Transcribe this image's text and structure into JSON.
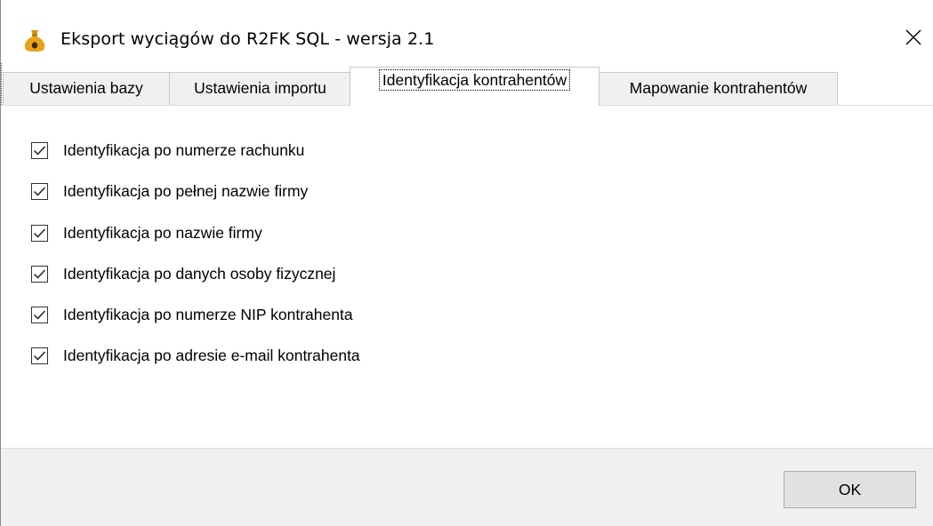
{
  "window": {
    "title": "Eksport wyciągów do R2FK SQL - wersja 2.1",
    "app_icon": "money-bag-icon",
    "close_icon": "close-icon"
  },
  "tabs": [
    {
      "label": "Ustawienia bazy",
      "active": false
    },
    {
      "label": "Ustawienia importu",
      "active": false
    },
    {
      "label": "Identyfikacja kontrahentów",
      "active": true
    },
    {
      "label": "Mapowanie kontrahentów",
      "active": false
    }
  ],
  "options": [
    {
      "label": "Identyfikacja po numerze rachunku",
      "checked": true
    },
    {
      "label": "Identyfikacja po pełnej nazwie firmy",
      "checked": true
    },
    {
      "label": "Identyfikacja po nazwie firmy",
      "checked": true
    },
    {
      "label": "Identyfikacja po danych osoby fizycznej",
      "checked": true
    },
    {
      "label": "Identyfikacja po numerze NIP kontrahenta",
      "checked": true
    },
    {
      "label": "Identyfikacja po adresie e-mail kontrahenta",
      "checked": true
    }
  ],
  "footer": {
    "ok_label": "OK"
  },
  "colors": {
    "footer_bg": "#f0f0f0",
    "button_bg": "#e1e1e1",
    "tab_bg": "#f0f0f0",
    "icon_bag": "#e8a317"
  }
}
